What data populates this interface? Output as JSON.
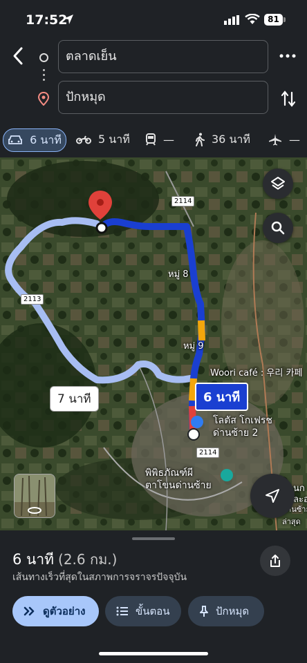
{
  "status": {
    "time": "17:52",
    "battery": "81"
  },
  "header": {
    "origin": "ตลาดเย็น",
    "destination": "ปักหมุด"
  },
  "modes": {
    "car": "6 นาที",
    "motorcycle": "5 นาที",
    "transit": "—",
    "walk": "36 นาที",
    "flight": "—"
  },
  "map": {
    "labels": {
      "moo8": "หมู่ 8",
      "moo9": "หมู่ 9",
      "cafe": "Woori café : 우리 카페",
      "lotus": "โลตัส โกเฟรช\nด่านซ้าย 2",
      "museum": "พิพิธภัณฑ์ผี\nตาโขนด่านซ้าย",
      "edge1": "นก",
      "edge2": "ละอ",
      "edge3": "ด่านซ้าย\nล่าสุด"
    },
    "shields": {
      "r2114_top": "2114",
      "r2113": "2113",
      "r2114_bottom": "2114"
    },
    "alt_route_time": "7 นาที",
    "main_route_time": "6 นาที"
  },
  "sheet": {
    "duration": "6 นาที",
    "distance": "(2.6 กม.)",
    "note": "เส้นทางเร็วที่สุดในสภาพการจราจรปัจจุบัน",
    "preview_label": "ดูตัวอย่าง",
    "steps_label": "ขั้นตอน",
    "pin_label": "ปักหมุด"
  },
  "colors": {
    "route_main": "#1a3fd1",
    "route_alt": "#a7bdf2",
    "traffic_slow": "#f2a60c",
    "accent": "#a8c7fa"
  }
}
